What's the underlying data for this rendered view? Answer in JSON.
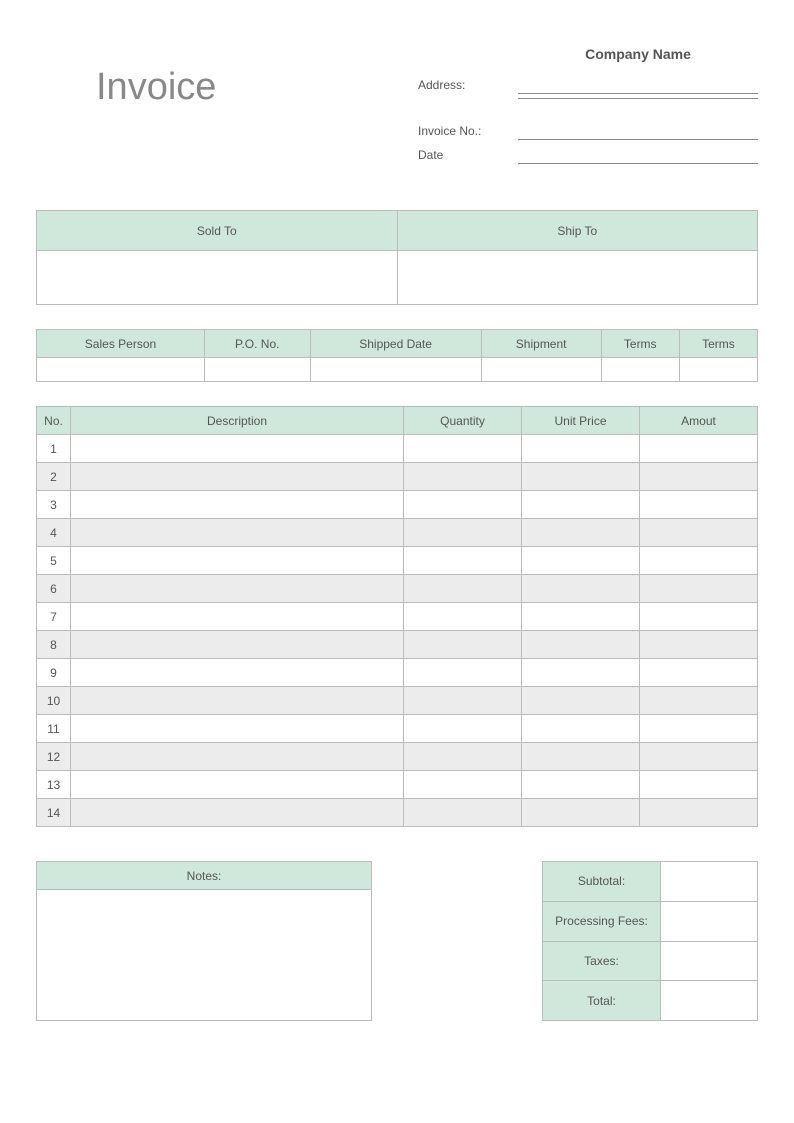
{
  "title": "Invoice",
  "company": {
    "name_label": "Company Name",
    "address_label": "Address:",
    "invoice_no_label": "Invoice No.:",
    "date_label": "Date"
  },
  "sold_ship": {
    "sold_to": "Sold To",
    "ship_to": "Ship To"
  },
  "details": {
    "cols": [
      "Sales Person",
      "P.O. No.",
      "Shipped Date",
      "Shipment",
      "Terms",
      "Terms"
    ]
  },
  "items": {
    "headers": {
      "no": "No.",
      "desc": "Description",
      "qty": "Quantity",
      "price": "Unit Price",
      "amt": "Amout"
    },
    "rows": [
      "1",
      "2",
      "3",
      "4",
      "5",
      "6",
      "7",
      "8",
      "9",
      "10",
      "11",
      "12",
      "13",
      "14"
    ]
  },
  "notes": {
    "header": "Notes:"
  },
  "totals": {
    "subtotal": "Subtotal:",
    "processing": "Processing Fees:",
    "taxes": "Taxes:",
    "total": "Total:"
  }
}
